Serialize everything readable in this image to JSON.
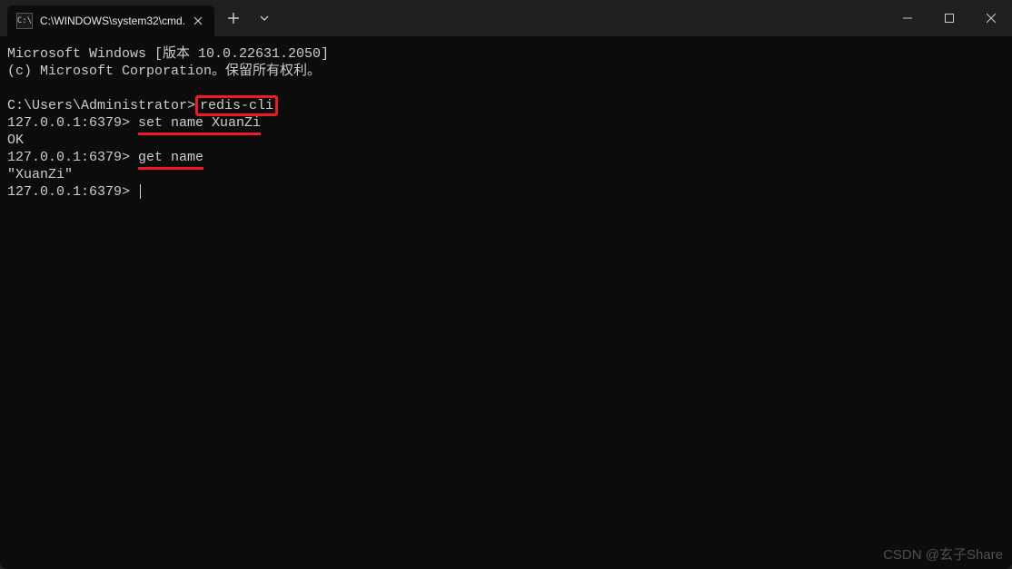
{
  "tab": {
    "icon_text": "C:\\",
    "title": "C:\\WINDOWS\\system32\\cmd."
  },
  "terminal": {
    "line1_a": "Microsoft Windows [版本 10.0.22631.2050]",
    "line2_a": "(c) Microsoft Corporation。保留所有权利。",
    "prompt1": "C:\\Users\\Administrator>",
    "cmd1": "redis-cli",
    "prompt2": "127.0.0.1:6379> ",
    "cmd2": "set name XuanZi",
    "out2": "OK",
    "prompt3": "127.0.0.1:6379> ",
    "cmd3": "get name",
    "out3": "\"XuanZi\"",
    "prompt4": "127.0.0.1:6379> "
  },
  "watermark": "CSDN @玄子Share"
}
